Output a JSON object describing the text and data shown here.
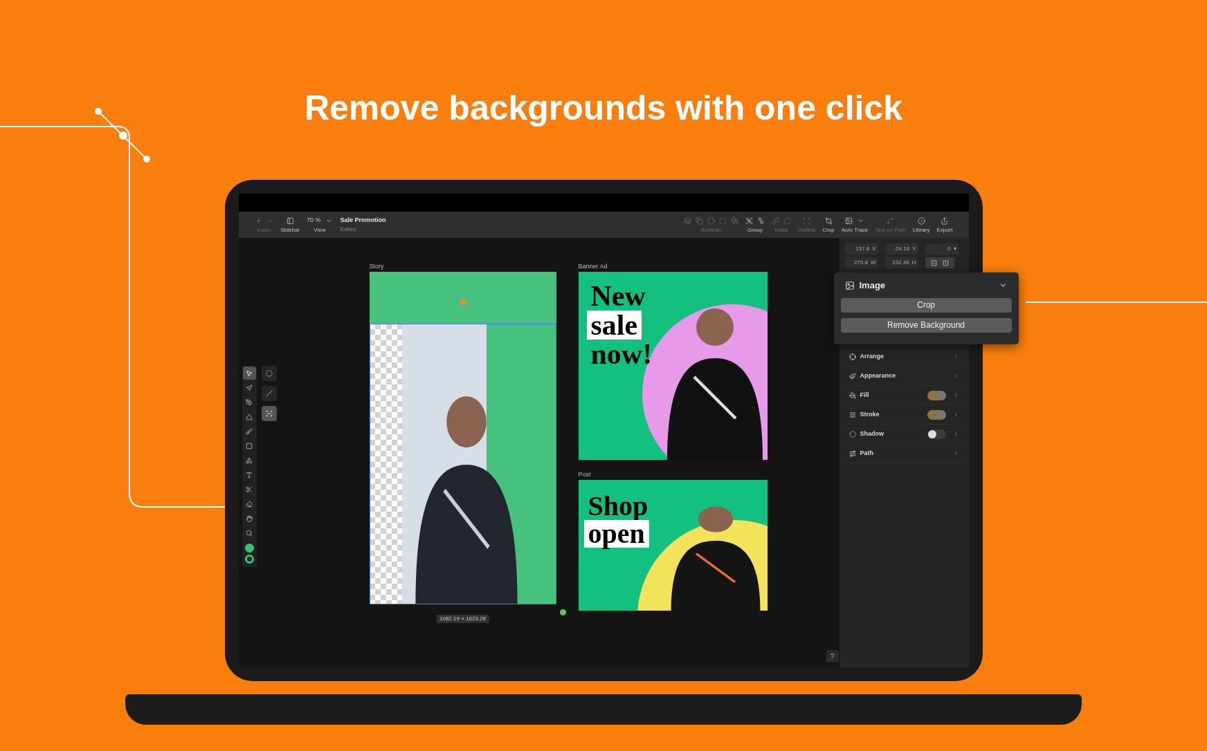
{
  "headline": "Remove backgrounds with one click",
  "toolbar": {
    "left": [
      {
        "kind": "insert",
        "label": "Insert",
        "disabled": true
      },
      {
        "kind": "sidebar",
        "label": "Sidebar",
        "disabled": false
      },
      {
        "kind": "zoom",
        "value": "70 %",
        "label": "View",
        "disabled": false
      }
    ],
    "document": {
      "title": "Sale Promotion",
      "status": "Edited"
    },
    "right": [
      {
        "kind": "boolean",
        "label": "Boolean",
        "disabled": true
      },
      {
        "kind": "group",
        "label": "Group",
        "disabled": false
      },
      {
        "kind": "mask",
        "label": "Mask",
        "disabled": true
      },
      {
        "kind": "outline",
        "label": "Outline",
        "disabled": true
      },
      {
        "kind": "crop",
        "label": "Crop",
        "disabled": false
      },
      {
        "kind": "trace",
        "label": "Auto Trace",
        "disabled": false
      },
      {
        "kind": "textpath",
        "label": "Text on Path",
        "disabled": true
      },
      {
        "kind": "library",
        "label": "Library",
        "disabled": false
      },
      {
        "kind": "export",
        "label": "Export",
        "disabled": false
      }
    ]
  },
  "tools": [
    {
      "kind": "select",
      "selected": true
    },
    {
      "kind": "direct",
      "selected": false
    },
    {
      "kind": "pen",
      "selected": false
    },
    {
      "kind": "vector",
      "selected": false
    },
    {
      "kind": "brush",
      "selected": false
    },
    {
      "kind": "rect",
      "selected": false
    },
    {
      "kind": "shape",
      "selected": false
    },
    {
      "kind": "text",
      "selected": false
    },
    {
      "kind": "knife",
      "selected": false
    },
    {
      "kind": "eraser",
      "selected": false
    },
    {
      "kind": "hand",
      "selected": false
    },
    {
      "kind": "zoom",
      "selected": false
    }
  ],
  "extra_tools": [
    {
      "kind": "circle",
      "selected": false
    },
    {
      "kind": "line",
      "selected": false
    },
    {
      "kind": "trace",
      "selected": true
    }
  ],
  "swatches": [
    {
      "kind": "fill",
      "color": "#3ec07a"
    },
    {
      "kind": "stroke",
      "color": "#3ec07a"
    }
  ],
  "artboards": [
    {
      "kind": "story",
      "label": "Story",
      "selection_size": "1082.19 × 1623.28"
    },
    {
      "kind": "banner",
      "label": "Banner Ad",
      "lines": [
        {
          "text": "New",
          "highlighted": false
        },
        {
          "text": "sale",
          "highlighted": true
        },
        {
          "text": "now!",
          "highlighted": false
        }
      ]
    },
    {
      "kind": "post",
      "label": "Post",
      "lines": [
        {
          "text": "Shop",
          "highlighted": false
        },
        {
          "text": "open",
          "highlighted": true
        }
      ]
    }
  ],
  "inspector": {
    "fields": [
      [
        {
          "value": "137.8",
          "label": "X"
        },
        {
          "value": "-24.18",
          "label": "Y"
        },
        {
          "value": "0",
          "label": "▾"
        }
      ],
      [
        {
          "value": "275.8",
          "label": "W"
        },
        {
          "value": "232.46",
          "label": "H"
        }
      ]
    ],
    "popup": {
      "title": "Image",
      "expanded": true,
      "buttons": [
        "Crop",
        "Remove Background"
      ]
    },
    "sections": [
      {
        "kind": "arrange",
        "label": "Arrange"
      },
      {
        "kind": "appearance",
        "label": "Appearance"
      },
      {
        "kind": "fill",
        "label": "Fill",
        "on": true
      },
      {
        "kind": "stroke",
        "label": "Stroke",
        "on": true
      },
      {
        "kind": "shadow",
        "label": "Shadow",
        "on": false
      },
      {
        "kind": "path",
        "label": "Path"
      }
    ]
  },
  "help": "?"
}
